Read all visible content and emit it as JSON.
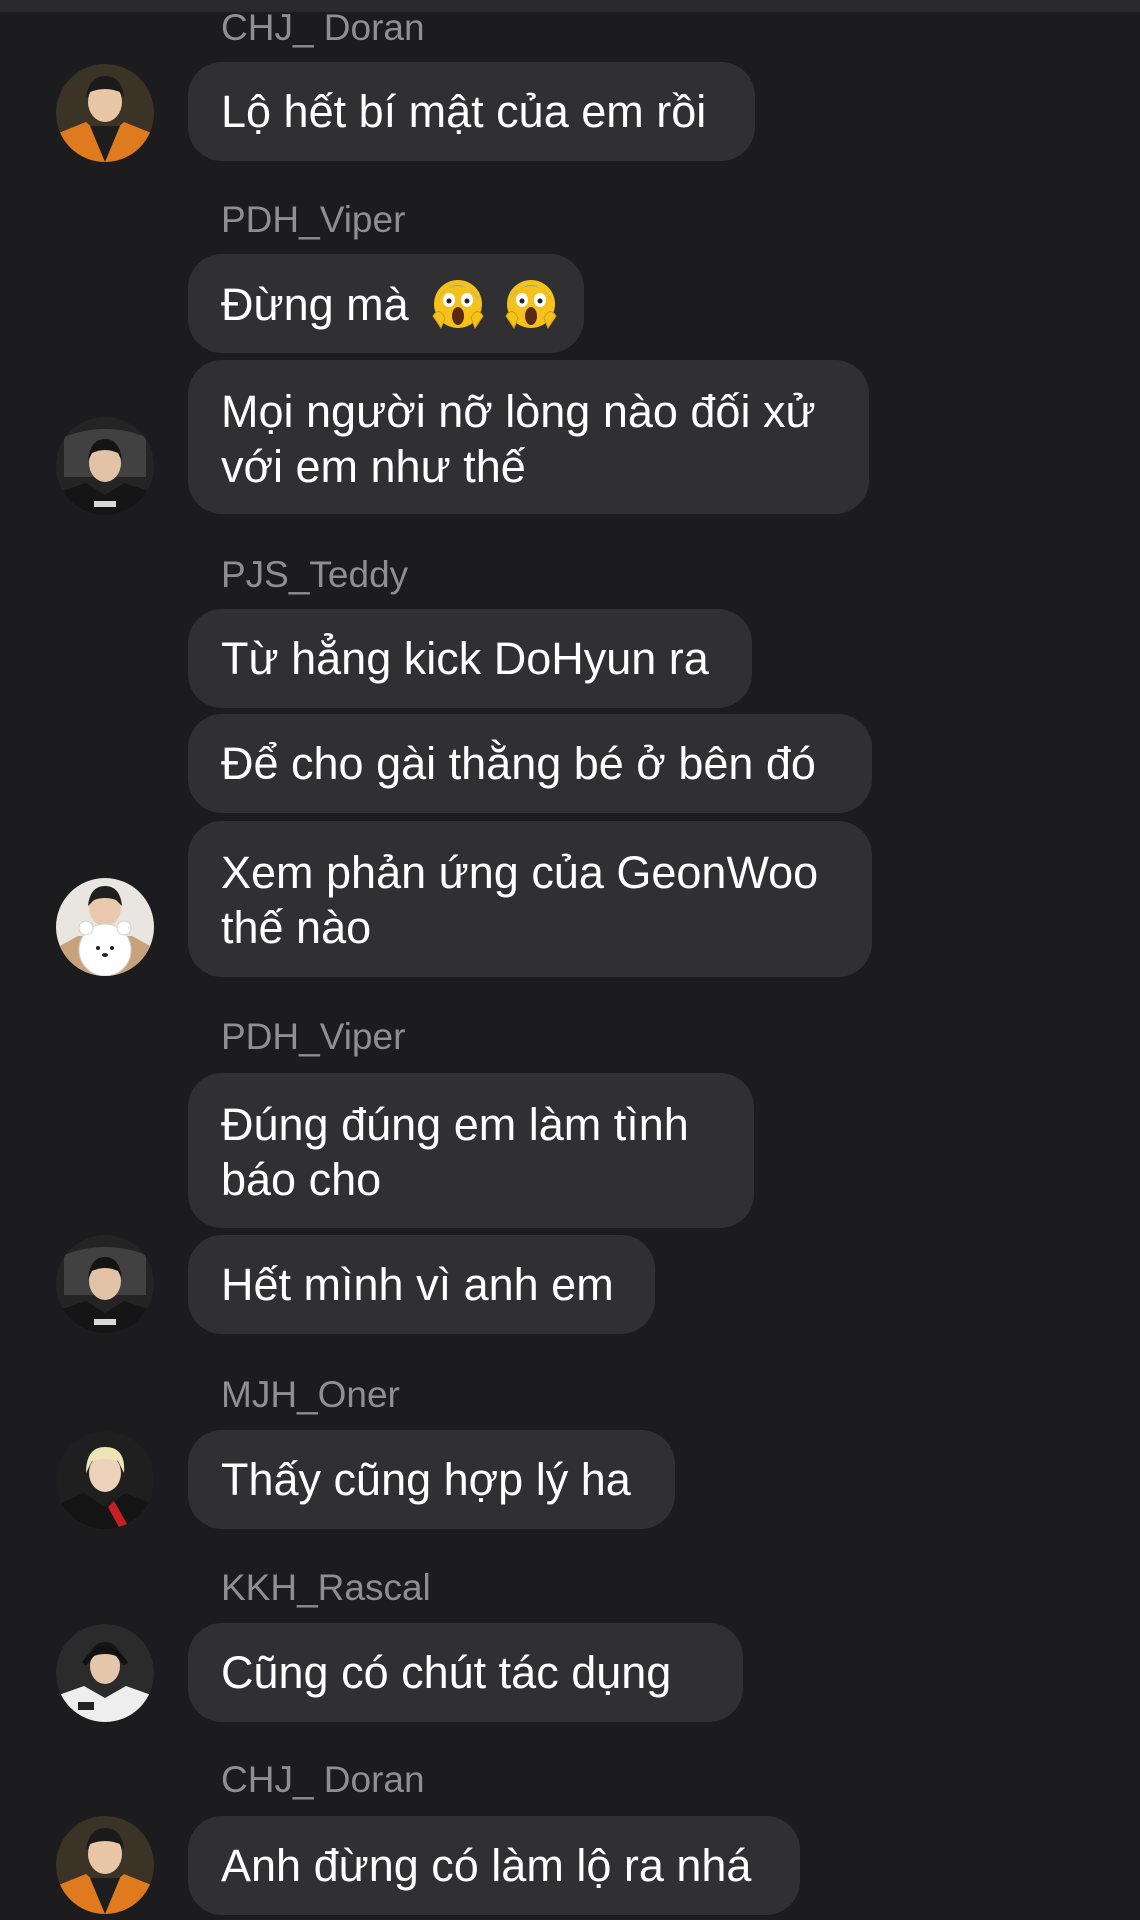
{
  "messages": [
    {
      "name": "CHJ_ Doran",
      "bubbles": [
        "Lộ hết bí mật của em rồi"
      ]
    },
    {
      "name": "PDH_Viper",
      "bubbles": [
        "Đừng mà",
        "Mọi người nỡ lòng nào đối xử",
        "với em như thế"
      ]
    },
    {
      "name": "PJS_Teddy",
      "bubbles": [
        "Từ hẳng kick DoHyun ra",
        "Để cho gài thằng bé ở bên đó",
        "Xem phản ứng của GeonWoo",
        "thế nào"
      ]
    },
    {
      "name": "PDH_Viper",
      "bubbles": [
        "Đúng đúng em làm tình",
        "báo cho",
        "Hết mình vì anh em"
      ]
    },
    {
      "name": "MJH_Oner",
      "bubbles": [
        "Thấy cũng hợp lý ha"
      ]
    },
    {
      "name": "KKH_Rascal",
      "bubbles": [
        "Cũng có chút tác dụng"
      ]
    },
    {
      "name": "CHJ_ Doran",
      "bubbles": [
        "Anh đừng có làm lộ ra nhá"
      ]
    }
  ],
  "icons": {
    "scream_emoji": "face-screaming-in-fear-icon"
  },
  "colors": {
    "background": "#1c1c1e",
    "bubble": "#303033",
    "sender_name": "#8e8e93",
    "message_text": "#ffffff"
  }
}
